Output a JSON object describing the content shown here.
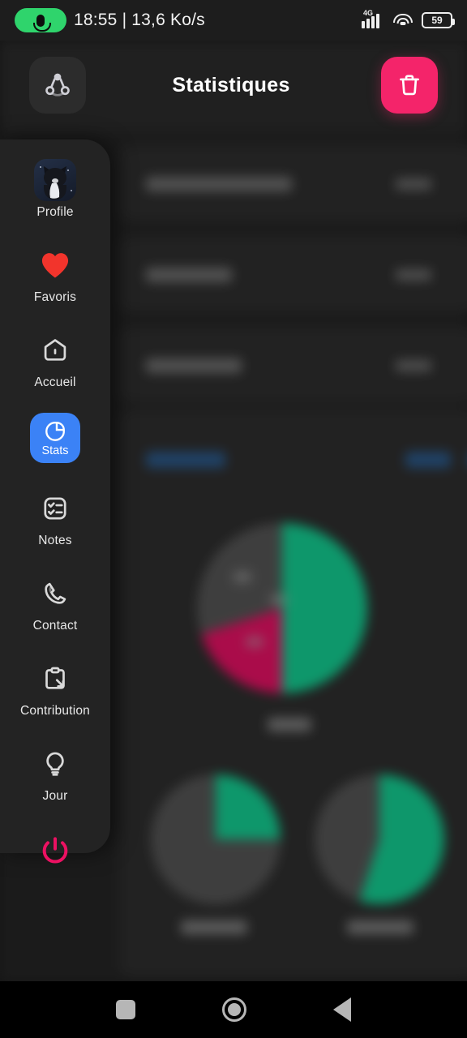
{
  "status_bar": {
    "mic_icon": "microphone-icon",
    "time": "18:55",
    "separator": "|",
    "network_speed": "13,6 Ko/s",
    "status_text": "18:55 | 13,6 Ko/s",
    "network_type": "4G",
    "signal_icon": "signal-bars-icon",
    "wifi_icon": "wifi-icon",
    "battery_level": "59",
    "battery_icon": "battery-icon"
  },
  "app_bar": {
    "share_icon": "share-nodes-icon",
    "title": "Statistiques",
    "delete_icon": "trash-icon",
    "delete_color": "#F4246A"
  },
  "drawer": {
    "background": "#232323",
    "active_color": "#3B82F6",
    "items": [
      {
        "id": "profile",
        "label": "Profile",
        "icon": "avatar-image",
        "active": false
      },
      {
        "id": "favoris",
        "label": "Favoris",
        "icon": "heart-icon",
        "active": false,
        "color": "#F2342C"
      },
      {
        "id": "accueil",
        "label": "Accueil",
        "icon": "home-icon",
        "active": false
      },
      {
        "id": "stats",
        "label": "Stats",
        "icon": "pie-chart-icon",
        "active": true
      },
      {
        "id": "notes",
        "label": "Notes",
        "icon": "checklist-icon",
        "active": false
      },
      {
        "id": "contact",
        "label": "Contact",
        "icon": "phone-icon",
        "active": false
      },
      {
        "id": "contribution",
        "label": "Contribution",
        "icon": "clipboard-arrow-icon",
        "active": false
      },
      {
        "id": "jour",
        "label": "Jour",
        "icon": "lightbulb-icon",
        "active": false
      }
    ],
    "power": {
      "id": "power",
      "icon": "power-icon",
      "color": "#EC1162",
      "label": ""
    }
  },
  "background_content": {
    "blurred": true,
    "note": "content behind the open drawer is blurred and unreadable",
    "stat_rows": [
      {
        "label": "",
        "value": ""
      },
      {
        "label": "",
        "value": ""
      },
      {
        "label": "",
        "value": ""
      }
    ],
    "card_title": "",
    "card_action": ""
  },
  "chart_data": [
    {
      "type": "pie",
      "title": "",
      "id": "main-pie",
      "categories": [
        "green",
        "pink",
        "grey"
      ],
      "values": [
        50,
        20,
        30
      ],
      "colors": [
        "#15D99A",
        "#F4126A",
        "#5A5A5A"
      ],
      "labels": [
        "",
        "",
        ""
      ],
      "legend": "none",
      "blurred": true
    },
    {
      "type": "pie",
      "title": "",
      "id": "small-pie-left",
      "categories": [
        "green",
        "grey"
      ],
      "values": [
        25,
        75
      ],
      "colors": [
        "#15D99A",
        "#5A5A5A"
      ],
      "labels": [
        "",
        ""
      ],
      "legend": "none",
      "blurred": true
    },
    {
      "type": "pie",
      "title": "",
      "id": "small-pie-right",
      "categories": [
        "green",
        "grey"
      ],
      "values": [
        55,
        45
      ],
      "colors": [
        "#15D99A",
        "#5A5A5A"
      ],
      "labels": [
        "",
        ""
      ],
      "legend": "none",
      "blurred": true
    }
  ],
  "nav_bar": {
    "recents_icon": "square-recents-icon",
    "home_icon": "circle-home-icon",
    "back_icon": "triangle-back-icon"
  }
}
